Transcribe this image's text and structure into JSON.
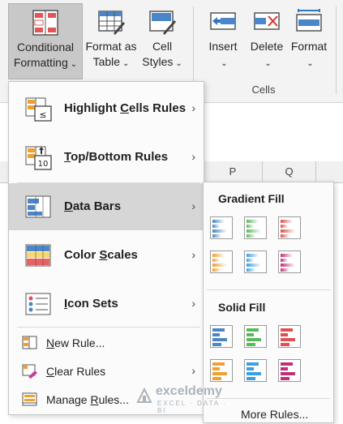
{
  "ribbon": {
    "buttons": [
      {
        "line1": "Conditional",
        "line2": "Formatting"
      },
      {
        "line1": "Format as",
        "line2": "Table"
      },
      {
        "line1": "Cell",
        "line2": "Styles"
      },
      {
        "line1": "Insert",
        "line2": ""
      },
      {
        "line1": "Delete",
        "line2": ""
      },
      {
        "line1": "Format",
        "line2": ""
      }
    ],
    "caret": "⌄",
    "group_label": "Cells"
  },
  "columns": [
    "P",
    "Q"
  ],
  "menu": {
    "items": [
      {
        "label": "Highlight Cells Rules",
        "icon": "highlight-cells-icon"
      },
      {
        "label": "Top/Bottom Rules",
        "icon": "top-bottom-icon"
      },
      {
        "label": "Data Bars",
        "icon": "data-bars-icon"
      },
      {
        "label": "Color Scales",
        "icon": "color-scales-icon"
      },
      {
        "label": "Icon Sets",
        "icon": "icon-sets-icon"
      }
    ],
    "small_items": [
      {
        "label": "New Rule...",
        "icon": "new-rule-icon"
      },
      {
        "label": "Clear Rules",
        "icon": "clear-rules-icon"
      },
      {
        "label": "Manage Rules...",
        "icon": "manage-rules-icon"
      }
    ],
    "icon_text": {
      "highlight": "≤",
      "topbottom": "10"
    },
    "arrow": "›"
  },
  "submenu": {
    "gradient_heading": "Gradient Fill",
    "solid_heading": "Solid Fill",
    "more": "More Rules...",
    "bar_colors": [
      "#4a86c8",
      "#5cb85c",
      "#e05050",
      "#f0a030",
      "#3aa0e0",
      "#c0307a"
    ]
  },
  "watermark": {
    "name": "exceldemy",
    "tagline": "EXCEL · DATA · BI"
  },
  "colors": {
    "highlight": "#d6d6d6",
    "accent": "#2f78c4"
  }
}
